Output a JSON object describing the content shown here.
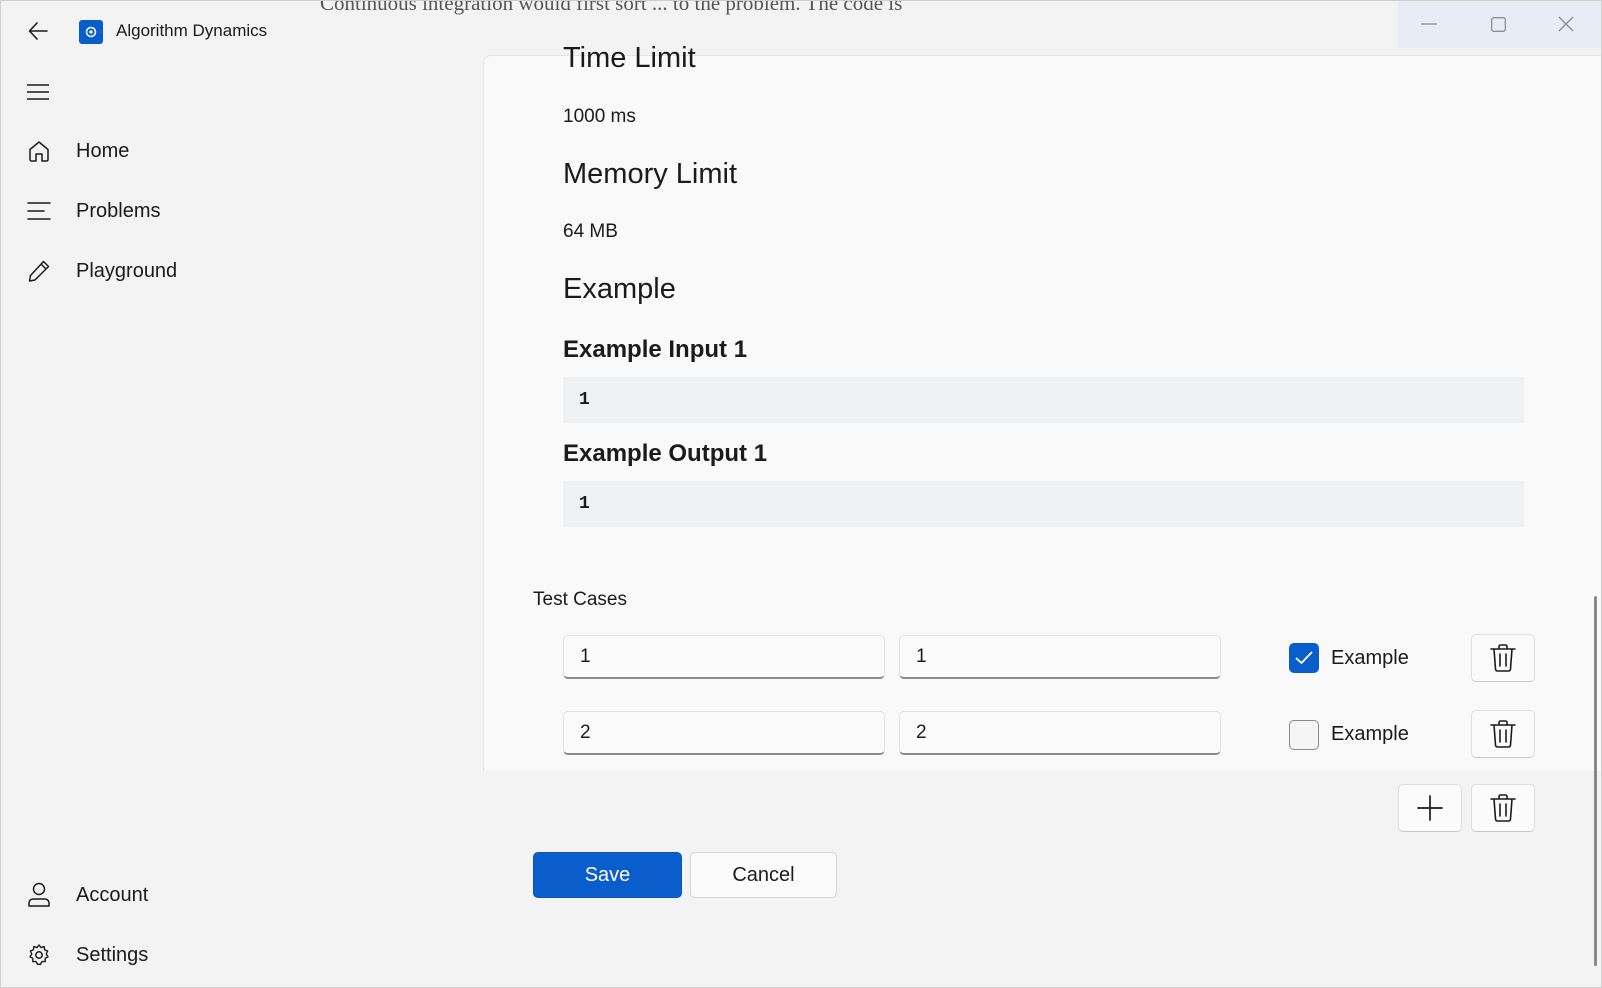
{
  "window": {
    "title": "Algorithm Dynamics",
    "bleed_text": "Continuous integration would first sort ... to the problem. The code is"
  },
  "nav": {
    "items": [
      {
        "label": "Home",
        "icon": "home-icon"
      },
      {
        "label": "Problems",
        "icon": "list-icon"
      },
      {
        "label": "Playground",
        "icon": "pencil-icon"
      }
    ],
    "footer": [
      {
        "label": "Account",
        "icon": "person-icon"
      },
      {
        "label": "Settings",
        "icon": "gear-icon"
      }
    ]
  },
  "problem": {
    "time_limit_heading": "Time Limit",
    "time_limit_value": "1000 ms",
    "memory_limit_heading": "Memory Limit",
    "memory_limit_value": "64 MB",
    "example_heading": "Example",
    "example_input_heading": "Example Input 1",
    "example_input_value": "1",
    "example_output_heading": "Example Output 1",
    "example_output_value": "1"
  },
  "test_cases": {
    "heading": "Test Cases",
    "rows": [
      {
        "input": "1",
        "output": "1",
        "example_label": "Example",
        "is_example": true
      },
      {
        "input": "2",
        "output": "2",
        "example_label": "Example",
        "is_example": false
      }
    ]
  },
  "actions": {
    "save_label": "Save",
    "cancel_label": "Cancel"
  },
  "colors": {
    "accent": "#0a5ecc",
    "background": "#f3f3f3",
    "card": "#f9f9f9"
  }
}
